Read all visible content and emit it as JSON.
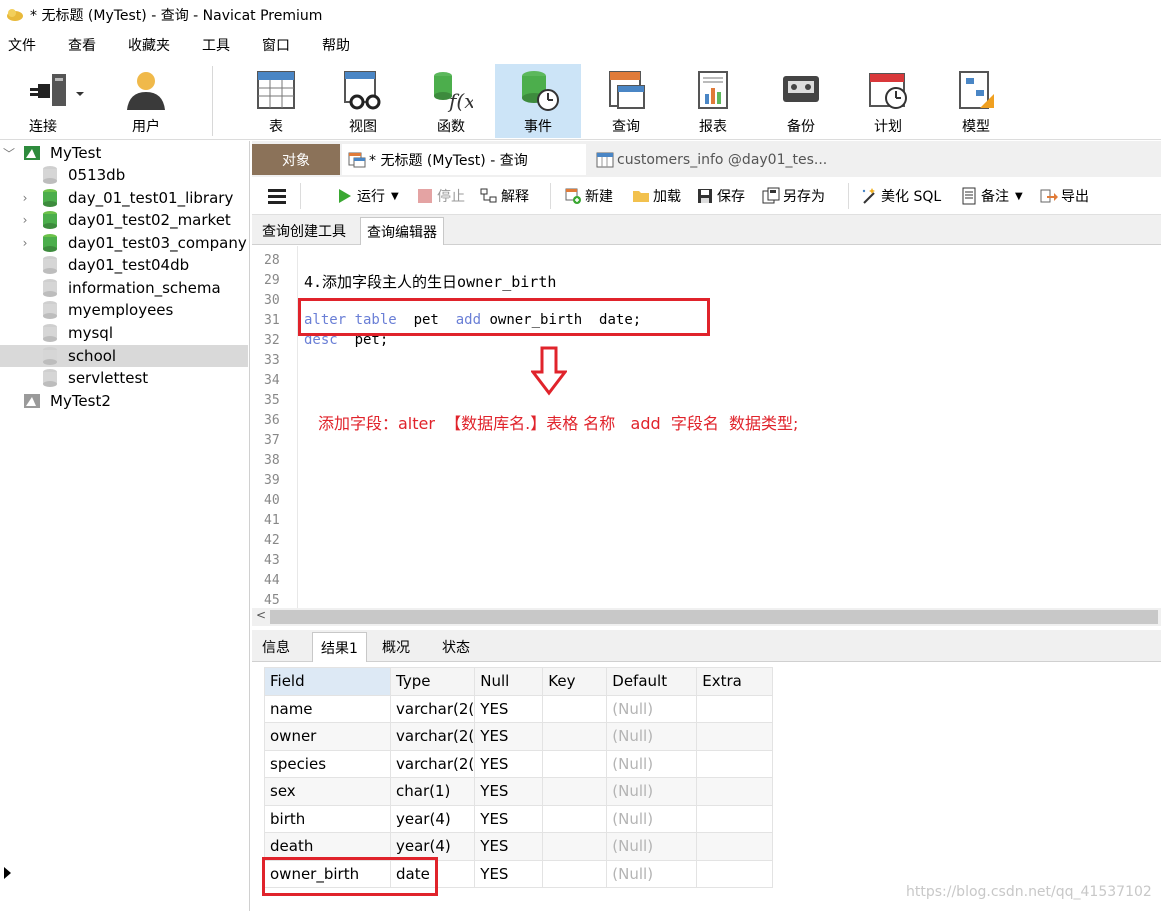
{
  "window": {
    "title": "* 无标题 (MyTest) - 查询 - Navicat Premium"
  },
  "menu": [
    "文件",
    "查看",
    "收藏夹",
    "工具",
    "窗口",
    "帮助"
  ],
  "toolbar": {
    "connect": "连接",
    "user": "用户",
    "table": "表",
    "view": "视图",
    "function": "函数",
    "event": "事件",
    "query": "查询",
    "report": "报表",
    "backup": "备份",
    "schedule": "计划",
    "model": "模型"
  },
  "tree": {
    "conn1": "MyTest",
    "dbs": [
      "0513db",
      "day_01_test01_library",
      "day01_test02_market",
      "day01_test03_company",
      "day01_test04db",
      "information_schema",
      "myemployees",
      "mysql",
      "school",
      "servlettest"
    ],
    "conn2": "MyTest2"
  },
  "tabs": {
    "objects": "对象",
    "query_tab": "* 无标题 (MyTest) - 查询",
    "customers_tab": "customers_info @day01_tes..."
  },
  "qtoolbar": {
    "run": "运行",
    "stop": "停止",
    "explain": "解释",
    "new": "新建",
    "load": "加载",
    "save": "保存",
    "save_as": "另存为",
    "beautify": "美化 SQL",
    "note": "备注",
    "export": "导出"
  },
  "subtabs": {
    "builder": "查询创建工具",
    "editor": "查询编辑器"
  },
  "editor": {
    "line_numbers": [
      "28",
      "29",
      "30",
      "31",
      "32",
      "33",
      "34",
      "35",
      "36",
      "37",
      "38",
      "39",
      "40",
      "41",
      "42",
      "43",
      "44",
      "45"
    ],
    "line29": "4.添加字段主人的生日owner_birth",
    "line31_kw1": "alter table",
    "line31_mid": "  pet  ",
    "line31_kw2": "add",
    "line31_rest": " owner_birth  date;",
    "line32_kw": "desc",
    "line32_rest": "  pet;",
    "annotation": "添加字段：alter  【数据库名.】表格 名称   add  字段名  数据类型;"
  },
  "result_tabs": {
    "info": "信息",
    "result1": "结果1",
    "profile": "概况",
    "status": "状态"
  },
  "grid": {
    "headers": [
      "Field",
      "Type",
      "Null",
      "Key",
      "Default",
      "Extra"
    ],
    "rows": [
      [
        "name",
        "varchar(2(",
        "YES",
        "",
        "(Null)",
        ""
      ],
      [
        "owner",
        "varchar(2(",
        "YES",
        "",
        "(Null)",
        ""
      ],
      [
        "species",
        "varchar(2(",
        "YES",
        "",
        "(Null)",
        ""
      ],
      [
        "sex",
        "char(1)",
        "YES",
        "",
        "(Null)",
        ""
      ],
      [
        "birth",
        "year(4)",
        "YES",
        "",
        "(Null)",
        ""
      ],
      [
        "death",
        "year(4)",
        "YES",
        "",
        "(Null)",
        ""
      ],
      [
        "owner_birth",
        "date",
        "YES",
        "",
        "(Null)",
        ""
      ]
    ]
  },
  "watermark": "https://blog.csdn.net/qq_41537102"
}
